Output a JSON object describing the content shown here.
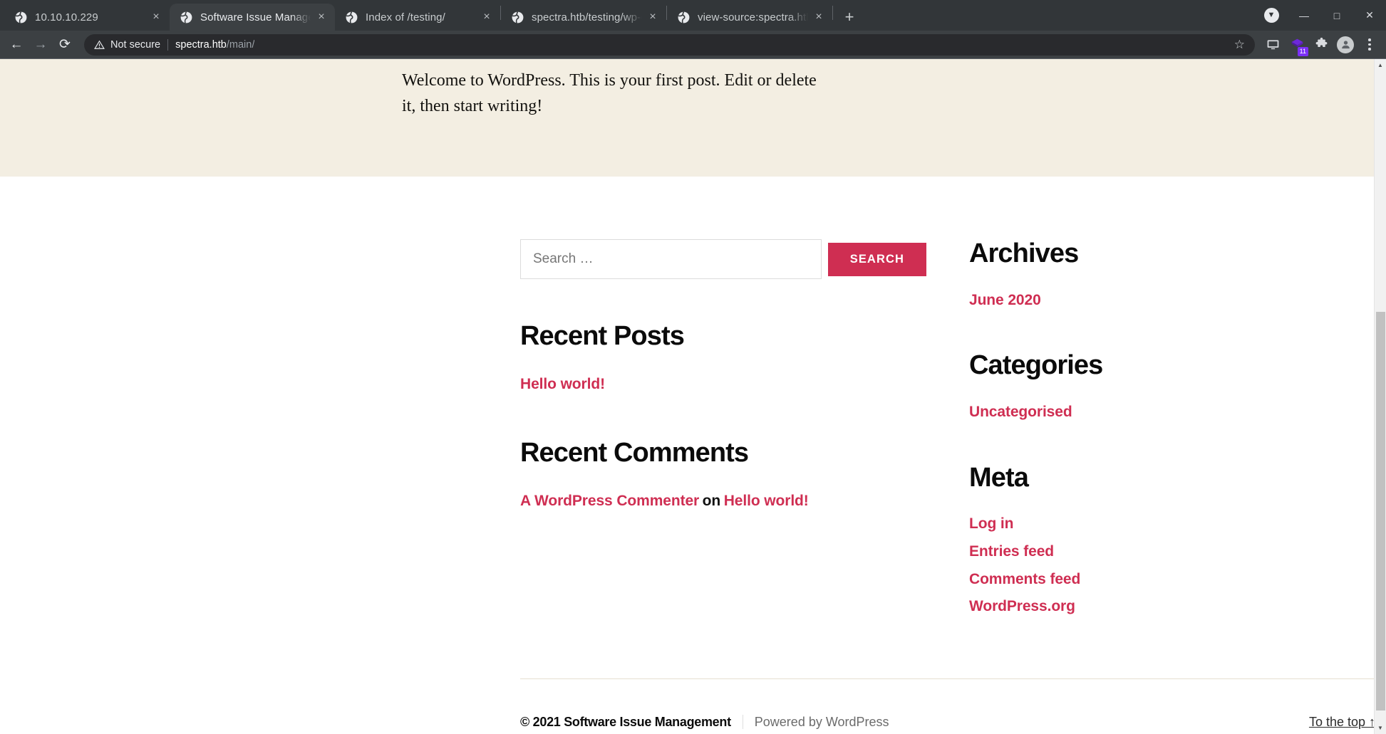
{
  "browser": {
    "tabs": [
      {
        "title": "10.10.10.229",
        "favicon": "globe-icon",
        "active": false
      },
      {
        "title": "Software Issue Manageme",
        "favicon": "globe-icon",
        "active": true
      },
      {
        "title": "Index of /testing/",
        "favicon": "globe-icon",
        "active": false
      },
      {
        "title": "spectra.htb/testing/wp-co",
        "favicon": "globe-icon",
        "active": false
      },
      {
        "title": "view-source:spectra.htb/t",
        "favicon": "globe-icon",
        "active": false
      }
    ],
    "new_tab_label": "+",
    "tab_close_label": "×",
    "window_controls": {
      "download_label": "▼",
      "minimize_label": "—",
      "maximize_label": "□",
      "close_label": "✕"
    },
    "toolbar": {
      "back_label": "←",
      "forward_label": "→",
      "reload_label": "⟳",
      "security_text": "Not secure",
      "url_host": "spectra.htb",
      "url_path": "/main/",
      "bookmark_label": "☆",
      "cast_label": "cast-icon",
      "extension_badge": "11",
      "extensions_label": "puzzle-icon",
      "profile_label": "avatar-icon",
      "menu_label": "kebab-menu-icon"
    }
  },
  "page": {
    "hero": {
      "excerpt": "Welcome to WordPress. This is your first post. Edit or delete it, then start writing!"
    },
    "search": {
      "placeholder": "Search …",
      "value": "",
      "button_label": "SEARCH"
    },
    "widgets_left": [
      {
        "title": "Recent Posts",
        "items": [
          {
            "text": "Hello world!",
            "type": "link"
          }
        ]
      },
      {
        "title": "Recent Comments",
        "items": [
          {
            "text": "A WordPress Commenter",
            "type": "link"
          },
          {
            "text": "on",
            "type": "plain"
          },
          {
            "text": "Hello world!",
            "type": "link"
          }
        ]
      }
    ],
    "widgets_right": [
      {
        "title": "Archives",
        "items": [
          {
            "text": "June 2020",
            "type": "link"
          }
        ]
      },
      {
        "title": "Categories",
        "items": [
          {
            "text": "Uncategorised",
            "type": "link"
          }
        ]
      },
      {
        "title": "Meta",
        "items": [
          {
            "text": "Log in",
            "type": "link"
          },
          {
            "text": "Entries feed",
            "type": "link"
          },
          {
            "text": "Comments feed",
            "type": "link"
          },
          {
            "text": "WordPress.org",
            "type": "link"
          }
        ]
      }
    ],
    "footer": {
      "copyright": "© 2021 Software Issue Management",
      "powered_by": "Powered by WordPress",
      "to_top": "To the top ↑"
    }
  },
  "colors": {
    "accent": "#cf2e52",
    "hero_bg": "#f3eee2",
    "heading": "#0b0b0b",
    "chrome_tabstrip": "#323639",
    "chrome_toolbar": "#3c4043",
    "extension_badge": "#7b2ff7"
  },
  "scrollbar": {
    "up_label": "▲",
    "down_label": "▼"
  }
}
